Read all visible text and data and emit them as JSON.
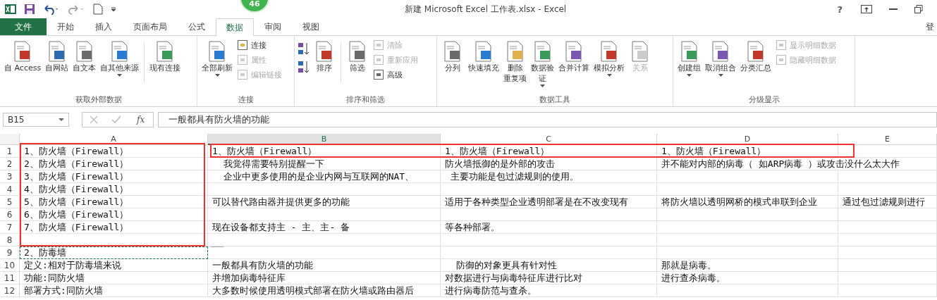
{
  "title_bar": {
    "title": "新建 Microsoft Excel 工作表.xlsx - Excel",
    "help": "?"
  },
  "badge": {
    "text": "46"
  },
  "tabs": [
    {
      "label": "文件",
      "kind": "file",
      "selected": false
    },
    {
      "label": "开始",
      "kind": "tab",
      "selected": false
    },
    {
      "label": "插入",
      "kind": "tab",
      "selected": false
    },
    {
      "label": "页面布局",
      "kind": "tab",
      "selected": false
    },
    {
      "label": "公式",
      "kind": "tab",
      "selected": false
    },
    {
      "label": "数据",
      "kind": "tab",
      "selected": true
    },
    {
      "label": "审阅",
      "kind": "tab",
      "selected": false
    },
    {
      "label": "视图",
      "kind": "tab",
      "selected": false
    }
  ],
  "account": "登",
  "ribbon": [
    {
      "label": "获取外部数据",
      "tools": [
        {
          "kind": "large",
          "label": "自 Access",
          "dropdown": false,
          "disabled": false
        },
        {
          "kind": "large",
          "label": "自网站",
          "dropdown": false,
          "disabled": false
        },
        {
          "kind": "large",
          "label": "自文本",
          "dropdown": false,
          "disabled": false
        },
        {
          "kind": "large",
          "label": "自其他来源",
          "dropdown": true,
          "disabled": false
        },
        {
          "kind": "separator"
        },
        {
          "kind": "large",
          "label": "现有连接",
          "dropdown": false,
          "disabled": false
        }
      ]
    },
    {
      "label": "连接",
      "tools": [
        {
          "kind": "large",
          "label": "全部刷新",
          "dropdown": true,
          "disabled": false
        },
        {
          "kind": "stack",
          "items": [
            {
              "label": "连接",
              "disabled": false
            },
            {
              "label": "属性",
              "disabled": true
            },
            {
              "label": "编辑链接",
              "disabled": true
            }
          ]
        }
      ]
    },
    {
      "label": "排序和筛选",
      "tools": [
        {
          "kind": "sortpair"
        },
        {
          "kind": "large",
          "label": "排序",
          "dropdown": false,
          "disabled": false
        },
        {
          "kind": "separator"
        },
        {
          "kind": "large",
          "label": "筛选",
          "dropdown": false,
          "disabled": false
        },
        {
          "kind": "stack",
          "items": [
            {
              "label": "清除",
              "disabled": true
            },
            {
              "label": "重新应用",
              "disabled": true
            },
            {
              "label": "高级",
              "disabled": false
            }
          ]
        }
      ]
    },
    {
      "label": "数据工具",
      "tools": [
        {
          "kind": "large",
          "label": "分列",
          "dropdown": false,
          "disabled": false
        },
        {
          "kind": "large",
          "label": "快速填充",
          "dropdown": false,
          "disabled": false
        },
        {
          "kind": "large",
          "lines": [
            "删除",
            "重复项"
          ],
          "dropdown": false,
          "disabled": false
        },
        {
          "kind": "large",
          "lines": [
            "数据验",
            "证"
          ],
          "dropdown": true,
          "disabled": false
        },
        {
          "kind": "large",
          "label": "合并计算",
          "dropdown": false,
          "disabled": false
        },
        {
          "kind": "large",
          "label": "模拟分析",
          "dropdown": true,
          "disabled": false
        },
        {
          "kind": "large",
          "label": "关系",
          "dropdown": false,
          "disabled": true
        }
      ]
    },
    {
      "label": "分级显示",
      "tools": [
        {
          "kind": "large",
          "label": "创建组",
          "dropdown": true,
          "disabled": false
        },
        {
          "kind": "large",
          "label": "取消组合",
          "dropdown": true,
          "disabled": false
        },
        {
          "kind": "large",
          "label": "分类汇总",
          "dropdown": false,
          "disabled": false
        },
        {
          "kind": "stack",
          "items": [
            {
              "label": "显示明细数据",
              "disabled": true
            },
            {
              "label": "隐藏明细数据",
              "disabled": true
            }
          ]
        }
      ]
    }
  ],
  "formula_bar": {
    "name_box": "B15",
    "function_label": "fx",
    "formula": "一般都具有防火墙的功能"
  },
  "sheet": {
    "columns": [
      {
        "label": "A",
        "selected": false
      },
      {
        "label": "B",
        "selected": true
      },
      {
        "label": "C",
        "selected": false
      },
      {
        "label": "D",
        "selected": false
      },
      {
        "label": "E",
        "selected": false
      }
    ],
    "rows": [
      {
        "label": "1",
        "copied": false,
        "cells": [
          "1、防火墙（Firewall）",
          "1、防火墙（Firewall）",
          "1、防火墙（Firewall）",
          "1、防火墙（Firewall）",
          ""
        ]
      },
      {
        "label": "2",
        "copied": false,
        "cells": [
          "2、防火墙（Firewall）",
          "  我觉得需要特别提醒一下",
          "防火墙抵御的是外部的攻击",
          "并不能对内部的病毒（ 如ARP病毒 ）或攻击没什么太大作",
          ""
        ]
      },
      {
        "label": "3",
        "copied": false,
        "cells": [
          "3、防火墙（Firewall）",
          "  企业中更多使用的是企业内网与互联网的NAT、",
          " 主要功能是包过滤规则的使用。",
          "",
          ""
        ]
      },
      {
        "label": "4",
        "copied": false,
        "cells": [
          "4、防火墙（Firewall）",
          "",
          "",
          "",
          ""
        ]
      },
      {
        "label": "5",
        "copied": false,
        "cells": [
          "5、防火墙（Firewall）",
          "可以替代路由器并提供更多的功能",
          "适用于各种类型企业透明部署是在不改变现有",
          "将防火墙以透明网桥的模式串联到企业",
          "通过包过滤规则进行"
        ]
      },
      {
        "label": "6",
        "copied": false,
        "cells": [
          "6、防火墙（Firewall）",
          "",
          "",
          "",
          ""
        ]
      },
      {
        "label": "7",
        "copied": false,
        "cells": [
          "7、防火墙（Firewall）",
          "现在设备都支持主 - 主、主- 备",
          "等各种部署。",
          "",
          ""
        ]
      },
      {
        "label": "8",
        "copied": false,
        "cells": [
          "",
          "",
          "",
          "",
          ""
        ]
      },
      {
        "label": "9",
        "copied": true,
        "cells": [
          "2、防毒墙",
          "",
          "",
          "",
          ""
        ]
      },
      {
        "label": "10",
        "copied": false,
        "cells": [
          "定义:相对于防毒墙来说",
          "一般都具有防火墙的功能",
          "  防御的对象更具有针对性",
          "那就是病毒。",
          ""
        ]
      },
      {
        "label": "11",
        "copied": false,
        "cells": [
          "功能:同防火墙",
          "并增加病毒特征库",
          "对数据进行与病毒特征库进行比对",
          "进行查杀病毒。",
          ""
        ]
      },
      {
        "label": "12",
        "copied": false,
        "cells": [
          "部署方式:同防火墙",
          "大多数时候使用透明模式部署在防火墙或路由器后",
          "进行病毒防范与查杀。",
          "",
          ""
        ]
      }
    ]
  }
}
